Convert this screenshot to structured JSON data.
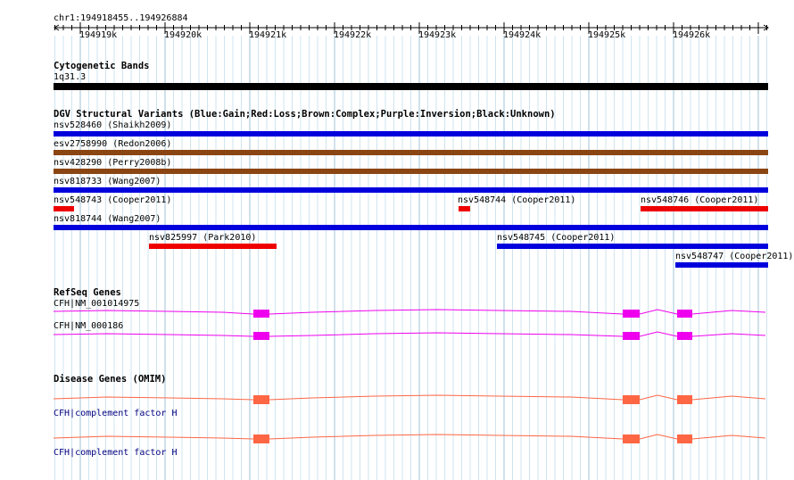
{
  "locus": "chr1:194918455..194926884",
  "ticks": [
    "194919k",
    "194920k",
    "194921k",
    "194922k",
    "194923k",
    "194924k",
    "194925k",
    "194926k"
  ],
  "cytoband": {
    "title": "Cytogenetic Bands",
    "label": "1q31.3",
    "color": "#000000"
  },
  "dgv": {
    "title": "DGV Structural Variants (Blue:Gain;Red:Loss;Brown:Complex;Purple:Inversion;Black:Unknown)",
    "colors": {
      "gain": "#0000dd",
      "loss": "#ee0000",
      "complex": "#8b4513"
    },
    "variants": [
      {
        "label": "nsv528460 (Shaikh2009)",
        "type": "gain"
      },
      {
        "label": "esv2758990 (Redon2006)",
        "type": "complex"
      },
      {
        "label": "nsv428290 (Perry2008b)",
        "type": "complex"
      },
      {
        "label": "nsv818733 (Wang2007)",
        "type": "gain"
      },
      {
        "label": "nsv548743 (Cooper2011)",
        "type": "loss"
      },
      {
        "label": "nsv548744 (Cooper2011)",
        "type": "loss"
      },
      {
        "label": "nsv548746 (Cooper2011)",
        "type": "loss"
      },
      {
        "label": "nsv818744 (Wang2007)",
        "type": "gain"
      },
      {
        "label": "nsv825997 (Park2010)",
        "type": "loss"
      },
      {
        "label": "nsv548745 (Cooper2011)",
        "type": "gain"
      },
      {
        "label": "nsv548747 (Cooper2011)",
        "type": "gain"
      }
    ]
  },
  "refseq": {
    "title": "RefSeq Genes",
    "color": "#ee00ee",
    "genes": [
      {
        "label": "CFH|NM_001014975"
      },
      {
        "label": "CFH|NM_000186"
      }
    ]
  },
  "omim": {
    "title": "Disease Genes (OMIM)",
    "color": "#ff6644",
    "genes": [
      {
        "label": "CFH|complement factor H"
      },
      {
        "label": "CFH|complement factor H"
      }
    ]
  }
}
